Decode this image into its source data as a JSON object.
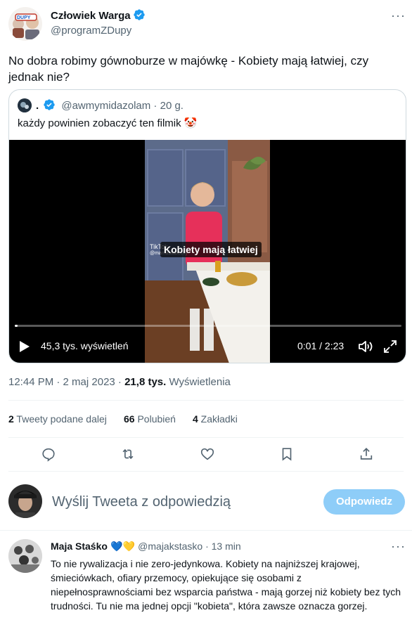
{
  "tweet": {
    "author_name": "Człowiek Warga",
    "author_handle": "@programZDupy",
    "more": "···",
    "text": "No dobra robimy gównoburze w majówkę - Kobiety mają łatwiej, czy jednak nie?",
    "timestamp": "12:44 PM · 2 maj 2023 · ",
    "views_count": "21,8 tys.",
    "views_label": " Wyświetlenia"
  },
  "quote": {
    "author_name": ".",
    "author_handle": "@awmymidazolam",
    "time": " · 20 g.",
    "text": "każdy powinien zobaczyć ten filmik 🤡",
    "video": {
      "caption": "Kobiety mają łatwiej",
      "tiktok_label": "TikTok",
      "tiktok_handle": "@mamastabecky",
      "views_overlay": "45,3 tys. wyświetleń",
      "time": "0:01 / 2:23",
      "progress": 0.007
    }
  },
  "stats": {
    "retweets_count": "2",
    "retweets_label": " Tweety podane dalej",
    "likes_count": "66",
    "likes_label": " Polubień",
    "bookmarks_count": "4",
    "bookmarks_label": " Zakładki"
  },
  "actions": [
    "reply-icon",
    "retweet-icon",
    "like-icon",
    "bookmark-icon",
    "share-icon"
  ],
  "compose": {
    "placeholder": "Wyślij Tweeta z odpowiedzią",
    "button": "Odpowiedz"
  },
  "reply": {
    "author_name": "Maja Staśko",
    "emoji": "💙💛",
    "author_handle": "@majakstasko",
    "time": " · 13 min",
    "more": "···",
    "text": "To nie rywalizacja i nie zero-jedynkowa. Kobiety na najniższej krajowej, śmieciówkach, ofiary przemocy, opiekujące się osobami z niepełnosprawnościami bez wsparcia państwa - mają gorzej niż kobiety bez tych trudności. Tu nie ma jednej opcji \"kobieta\", która zawsze oznacza gorzej."
  },
  "colors": {
    "accent": "#1d9bf0",
    "muted": "#536471",
    "reply_button": "#8ecdf8"
  }
}
